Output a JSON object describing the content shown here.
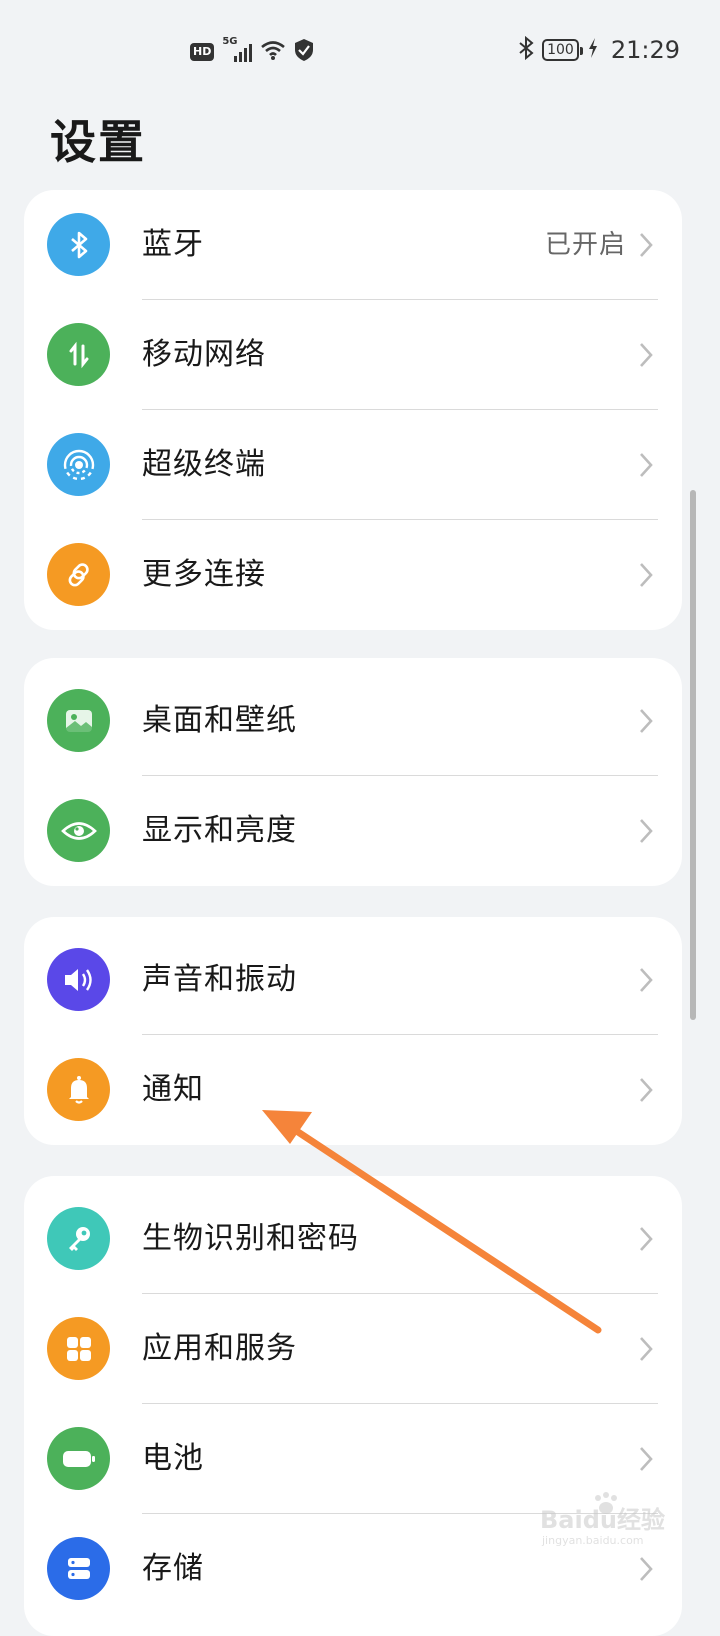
{
  "status_bar": {
    "hd_label": "HD",
    "network_label": "5G",
    "battery_level": "100",
    "time": "21:29"
  },
  "page_title": "设置",
  "groups": [
    {
      "items": [
        {
          "label": "蓝牙",
          "value": "已开启",
          "icon": "bluetooth-icon",
          "color": "#3fa9e8"
        },
        {
          "label": "移动网络",
          "icon": "mobile-data-icon",
          "color": "#4cb15a"
        },
        {
          "label": "超级终端",
          "icon": "super-device-icon",
          "color": "#3fa9e8"
        },
        {
          "label": "更多连接",
          "icon": "link-icon",
          "color": "#f59a23"
        }
      ]
    },
    {
      "items": [
        {
          "label": "桌面和壁纸",
          "icon": "wallpaper-icon",
          "color": "#4cb15a"
        },
        {
          "label": "显示和亮度",
          "icon": "eye-icon",
          "color": "#4cb15a"
        }
      ]
    },
    {
      "items": [
        {
          "label": "声音和振动",
          "icon": "speaker-icon",
          "color": "#5a48e8"
        },
        {
          "label": "通知",
          "icon": "bell-icon",
          "color": "#f59a23"
        }
      ]
    },
    {
      "items": [
        {
          "label": "生物识别和密码",
          "icon": "key-icon",
          "color": "#3fc8b8"
        },
        {
          "label": "应用和服务",
          "icon": "apps-grid-icon",
          "color": "#f59a23"
        },
        {
          "label": "电池",
          "icon": "battery-icon",
          "color": "#4cb15a"
        },
        {
          "label": "存储",
          "icon": "storage-icon",
          "color": "#2b6ce8"
        }
      ]
    }
  ],
  "watermark": {
    "brand": "Baidu经验",
    "domain": "jingyan.baidu.com"
  },
  "colors": {
    "annotation_arrow": "#f5843a",
    "background": "#f1f3f5"
  }
}
